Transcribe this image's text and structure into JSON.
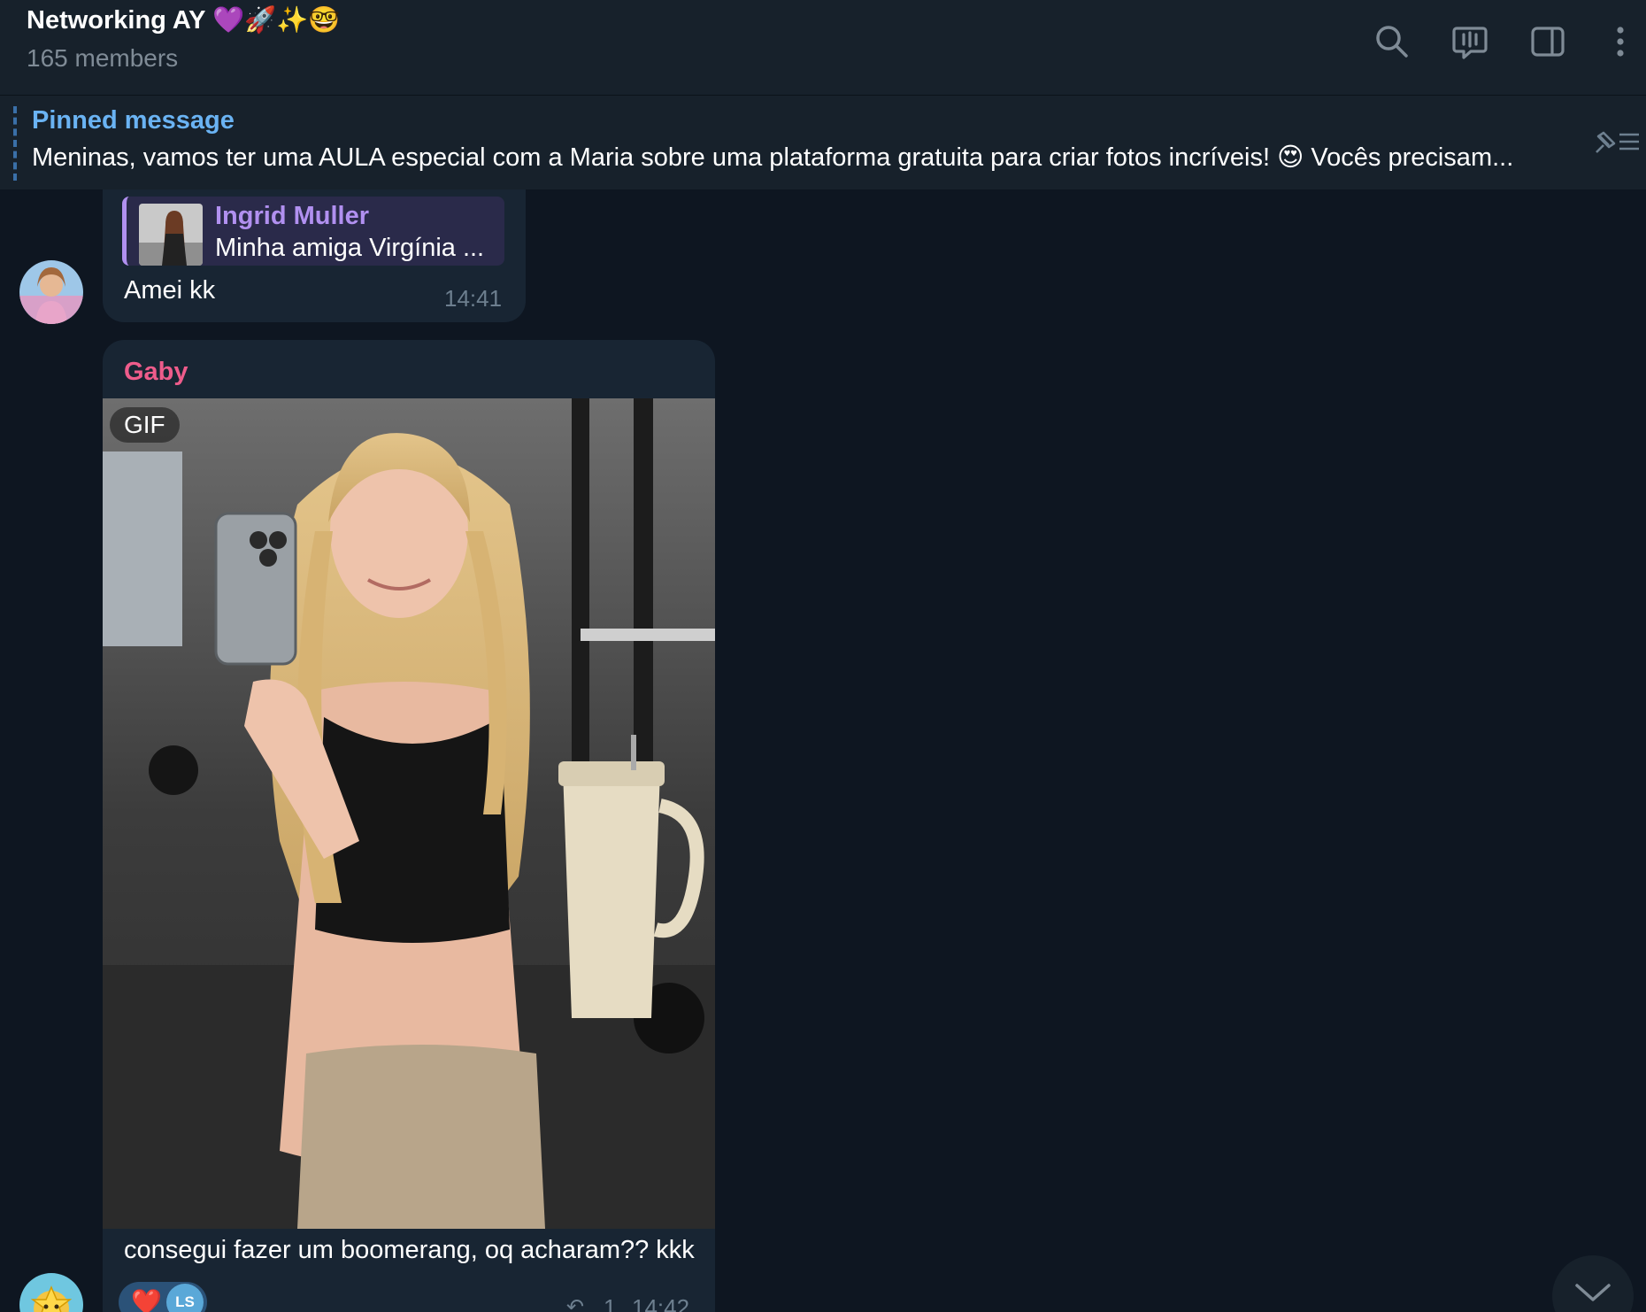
{
  "header": {
    "title": "Networking AY 💜🚀✨🤓",
    "members": "165 members"
  },
  "pinned": {
    "title": "Pinned message",
    "text": "Meninas, vamos ter uma AULA especial com a Maria  sobre uma plataforma gratuita para criar fotos incríveis! 😍  Vocês precisam..."
  },
  "messages": [
    {
      "reply": {
        "author": "Ingrid Muller",
        "text": "Minha amiga Virgínia ..."
      },
      "text": "Amei kk",
      "time": "14:41"
    },
    {
      "sender": "Gaby",
      "media_badge": "GIF",
      "caption": "consegui fazer um boomerang, oq acharam?? kkk",
      "reaction": {
        "emoji": "❤️",
        "user": "LS"
      },
      "replies": "1",
      "time": "14:42"
    }
  ],
  "colors": {
    "background": "#0e1621",
    "header": "#17212b",
    "bubble": "#182533",
    "accent": "#6ab3f3",
    "reply_author": "#b190f0",
    "sender_gaby": "#ee5c8b"
  }
}
